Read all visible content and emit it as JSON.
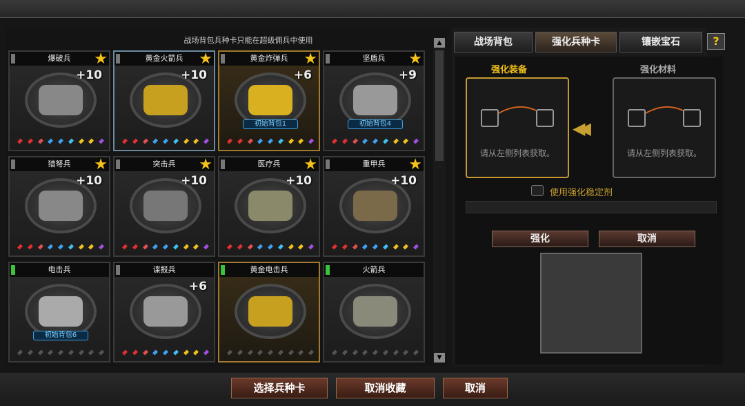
{
  "notice": "战场背包兵种卡只能在超级佣兵中使用",
  "tabs": [
    "战场背包",
    "强化兵种卡",
    "镶嵌宝石"
  ],
  "help_label": "?",
  "enhance": {
    "equip_title": "强化装备",
    "material_title": "强化材料",
    "hint": "请从左侧列表获取。",
    "stabilizer_label": "使用强化稳定剂",
    "enhance_button": "强化",
    "cancel_button": "取消"
  },
  "cards": [
    {
      "name": "爆破兵",
      "level": "+10",
      "star": true,
      "tag": "",
      "flag": "gray"
    },
    {
      "name": "黄金火箭兵",
      "level": "+10",
      "star": true,
      "tag": "",
      "flag": "gray"
    },
    {
      "name": "黄金炸弹兵",
      "level": "+6",
      "star": true,
      "tag": "初始背包1",
      "flag": "gray"
    },
    {
      "name": "坚盾兵",
      "level": "+9",
      "star": true,
      "tag": "初始背包4",
      "flag": "gray"
    },
    {
      "name": "猎弩兵",
      "level": "+10",
      "star": true,
      "tag": "",
      "flag": "gray"
    },
    {
      "name": "突击兵",
      "level": "+10",
      "star": true,
      "tag": "",
      "flag": "gray"
    },
    {
      "name": "医疗兵",
      "level": "+10",
      "star": true,
      "tag": "",
      "flag": "gray"
    },
    {
      "name": "重甲兵",
      "level": "+10",
      "star": true,
      "tag": "",
      "flag": "gray"
    },
    {
      "name": "电击兵",
      "level": "",
      "star": false,
      "tag": "初始背包6",
      "flag": "green"
    },
    {
      "name": "谍报兵",
      "level": "+6",
      "star": false,
      "tag": "",
      "flag": "gray"
    },
    {
      "name": "黄金电击兵",
      "level": "",
      "star": false,
      "tag": "",
      "flag": "green"
    },
    {
      "name": "火箭兵",
      "level": "",
      "star": false,
      "tag": "",
      "flag": "green"
    }
  ],
  "bottom_buttons": [
    "选择兵种卡",
    "取消收藏",
    "取消"
  ],
  "colors": {
    "accent_gold": "#f4c21a",
    "tag_blue": "#3ea0e0"
  }
}
